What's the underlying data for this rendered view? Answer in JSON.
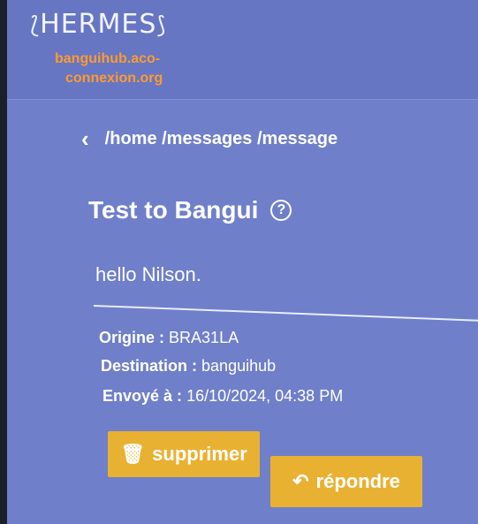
{
  "header": {
    "logo_text": "HERMES",
    "hub_line1": "banguihub.aco-",
    "hub_line2": "connexion.org"
  },
  "breadcrumb": {
    "path": "/home /messages /message"
  },
  "message": {
    "subject": "Test to Bangui",
    "body": "hello Nilson.",
    "origin_label": "Origine :",
    "origin_value": "BRA31LA",
    "destination_label": "Destination :",
    "destination_value": "banguihub",
    "sent_label": "Envoyé à :",
    "sent_value": "16/10/2024, 04:38 PM"
  },
  "actions": {
    "delete_label": "supprimer",
    "reply_label": "répondre"
  },
  "icons": {
    "back": "chevron-left-icon",
    "help": "question-circle-icon",
    "delete": "trash-icon",
    "reply": "reply-icon"
  },
  "colors": {
    "background": "#6f7fc9",
    "accent_orange": "#ff9a33",
    "button_yellow": "#e9b132"
  }
}
